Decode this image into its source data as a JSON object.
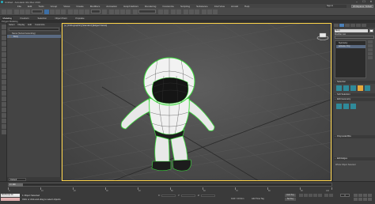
{
  "titlebar": {
    "title": "Untitled - Autodesk 3ds Max 2019",
    "controls": [
      "–",
      "☐",
      "✕"
    ]
  },
  "menubar": {
    "items": [
      "File",
      "Edit",
      "Tools",
      "Group",
      "Views",
      "Create",
      "Modifiers",
      "Animation",
      "Graph Editors",
      "Rendering",
      "Customize",
      "Scripting",
      "Substance",
      "Civil View",
      "Arnold",
      "Help"
    ],
    "signin": "Sign In",
    "workspace_label": "Workspaces: Default"
  },
  "ribbon": {
    "tabs": [
      "Modeling",
      "Freeform",
      "Selection",
      "Object Paint",
      "Populate"
    ],
    "active_tab": "Modeling",
    "subtitle": "Polygon Modeling"
  },
  "scene_explorer": {
    "menu": [
      "Select",
      "Display",
      "Edit",
      "Customize"
    ],
    "column_header": "Name (Sorted Ascending)",
    "rows": [
      {
        "label": "Body",
        "selected": true
      }
    ],
    "footer_dropdown": "Default"
  },
  "viewport": {
    "label": "[+] [Orthographic] [Standard] [Edged Faces]"
  },
  "command_panel": {
    "name": "Body",
    "modifier_list_label": "Modifier List",
    "stack": [
      {
        "label": "Symmetry",
        "selected": false
      },
      {
        "label": "Editable Poly",
        "selected": true
      }
    ],
    "rollouts": [
      "Selection",
      "Soft Selection",
      "Edit Geometry",
      "Polymodel Bits",
      "Edit Edges"
    ],
    "selection_note": "Whole Object Selected"
  },
  "timeline": {
    "position": "0 / 100",
    "ticks": [
      "0",
      "10",
      "20",
      "30",
      "40",
      "50",
      "60",
      "70",
      "80",
      "90",
      "100"
    ]
  },
  "statusbar": {
    "maxscript_label": "MAXScript Mi",
    "line1": "1 Object Selected",
    "line2": "Click or click-and-drag to select objects",
    "x_label": "X:",
    "y_label": "Y:",
    "z_label": "Z:",
    "grid": "Grid = 10.0cm",
    "time_tag": "Add Time Tag",
    "autokey": "Auto Key",
    "setkey": "Set Key",
    "frame": "0"
  },
  "colors": {
    "viewport_border": "#ffd54a",
    "selection_wire": "#3cdc3c",
    "accent_blue": "#4b80b8"
  }
}
